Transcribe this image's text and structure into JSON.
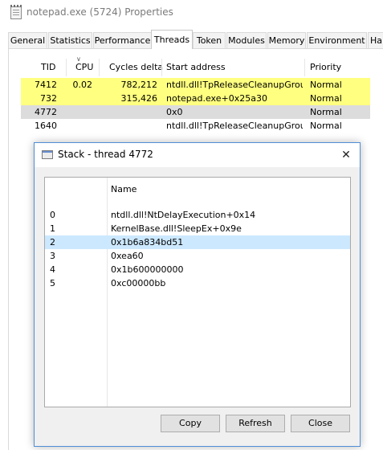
{
  "window": {
    "title": "notepad.exe (5724) Properties"
  },
  "tabs": [
    {
      "label": "General"
    },
    {
      "label": "Statistics"
    },
    {
      "label": "Performance"
    },
    {
      "label": "Threads",
      "active": true
    },
    {
      "label": "Token"
    },
    {
      "label": "Modules"
    },
    {
      "label": "Memory"
    },
    {
      "label": "Environment"
    },
    {
      "label": "Han"
    }
  ],
  "threads": {
    "columns": [
      "TID",
      "CPU",
      "Cycles delta",
      "Start address",
      "Priority"
    ],
    "rows": [
      {
        "tid": "7412",
        "cpu": "0.02",
        "cycles": "782,212",
        "start": "ntdll.dll!TpReleaseCleanupGroup...",
        "priority": "Normal",
        "highlight": "yellow"
      },
      {
        "tid": "732",
        "cpu": "",
        "cycles": "315,426",
        "start": "notepad.exe+0x25a30",
        "priority": "Normal",
        "highlight": "yellow"
      },
      {
        "tid": "4772",
        "cpu": "",
        "cycles": "",
        "start": "0x0",
        "priority": "Normal",
        "highlight": "selected"
      },
      {
        "tid": "1640",
        "cpu": "",
        "cycles": "",
        "start": "ntdll.dll!TpReleaseCleanupGroup...",
        "priority": "Normal",
        "highlight": "none"
      }
    ]
  },
  "stack_dialog": {
    "title": "Stack - thread 4772",
    "column_name": "Name",
    "frames": [
      {
        "index": "0",
        "name": "ntdll.dll!NtDelayExecution+0x14"
      },
      {
        "index": "1",
        "name": "KernelBase.dll!SleepEx+0x9e"
      },
      {
        "index": "2",
        "name": "0x1b6a834bd51",
        "selected": true
      },
      {
        "index": "3",
        "name": "0xea60"
      },
      {
        "index": "4",
        "name": "0x1b600000000"
      },
      {
        "index": "5",
        "name": "0xc00000bb"
      }
    ],
    "buttons": {
      "copy": "Copy",
      "refresh": "Refresh",
      "close": "Close"
    },
    "close_glyph": "✕"
  },
  "colors": {
    "highlight_yellow": "#ffff80",
    "selected_gray": "#dcdcdc",
    "stack_selection": "#cce8ff",
    "dialog_border": "#4f8ed6"
  }
}
